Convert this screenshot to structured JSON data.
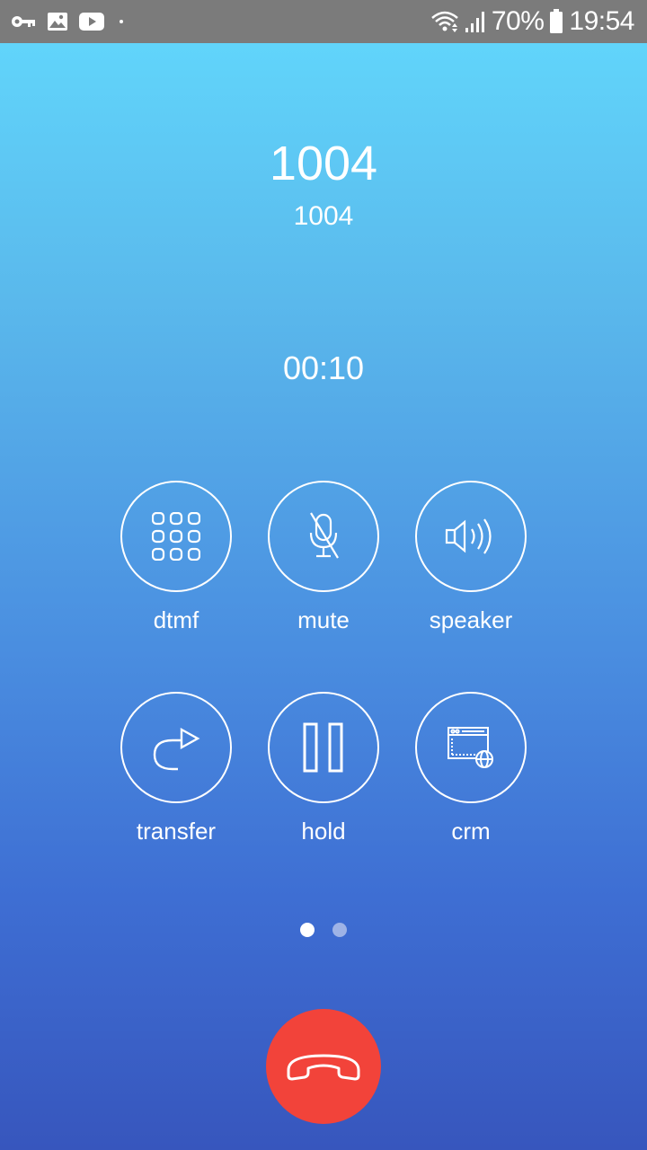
{
  "status_bar": {
    "battery_percent": "70%",
    "time": "19:54",
    "icons": [
      "vpn-key-icon",
      "image-icon",
      "youtube-icon",
      "dot-icon",
      "wifi-icon",
      "signal-icon",
      "battery-icon"
    ]
  },
  "call": {
    "display_name": "1004",
    "number": "1004",
    "duration": "00:10"
  },
  "controls": [
    {
      "label": "dtmf",
      "icon": "dialpad-icon"
    },
    {
      "label": "mute",
      "icon": "microphone-off-icon"
    },
    {
      "label": "speaker",
      "icon": "speaker-icon"
    },
    {
      "label": "transfer",
      "icon": "transfer-arrow-icon"
    },
    {
      "label": "hold",
      "icon": "pause-icon"
    },
    {
      "label": "crm",
      "icon": "browser-globe-icon"
    }
  ],
  "pager": {
    "current_page": 1,
    "total_pages": 2
  },
  "end_call": {
    "icon": "phone-hangup-icon"
  },
  "colors": {
    "gradient_top": "#62d9fd",
    "gradient_bottom": "#3756bd",
    "status_bar": "#7b7b7b",
    "hangup_red": "#f2433a",
    "inactive_dot": "#9eb3e6"
  }
}
